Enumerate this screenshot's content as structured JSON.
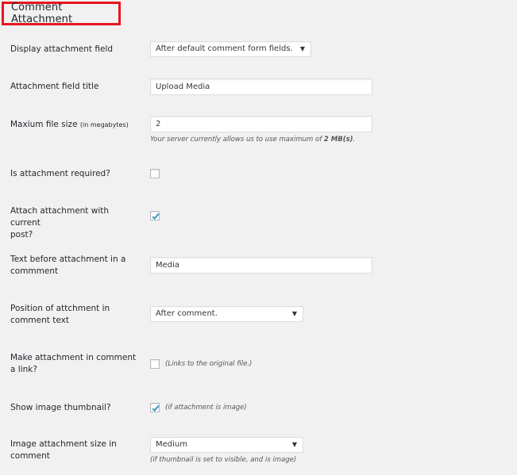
{
  "section_title": "Comment Attachment",
  "colors": {
    "highlight_border": "#e5161f",
    "check": "#1e8cbe",
    "background": "#f1f1f1"
  },
  "fields": {
    "display_field": {
      "label": "Display attachment field",
      "value": "After default comment form fields.",
      "icon": "dropdown-arrow-icon",
      "arrow": "▼"
    },
    "field_title": {
      "label": "Attachment field title",
      "value": "Upload Media"
    },
    "max_size": {
      "label": "Maxium file size",
      "label_small": "(in megabytes)",
      "value": "2",
      "hint_prefix": "Your server currently allows us to use maximum of ",
      "hint_bold": "2 MB(s)",
      "hint_suffix": "."
    },
    "required": {
      "label": "Is attachment required?",
      "checked": false
    },
    "attach_post": {
      "label_line1": "Attach attachment with current",
      "label_line2": "post?",
      "checked": true
    },
    "text_before": {
      "label_line1": "Text before attachment in a",
      "label_line2": "commment",
      "value": "Media"
    },
    "position": {
      "label_line1": "Position of attchment in",
      "label_line2": "comment text",
      "value": "After comment.",
      "arrow": "▼"
    },
    "make_link": {
      "label_line1": "Make attachment in comment",
      "label_line2": "a link?",
      "checked": false,
      "hint": "(Links to the original file.)"
    },
    "show_thumb": {
      "label": "Show image thumbnail?",
      "checked": true,
      "hint": "(if attachment is image)"
    },
    "image_size": {
      "label_line1": "Image attachment size in",
      "label_line2": "comment",
      "value": "Medium",
      "arrow": "▼",
      "hint": "(if thumbnail is set to visible, and is image)"
    }
  }
}
